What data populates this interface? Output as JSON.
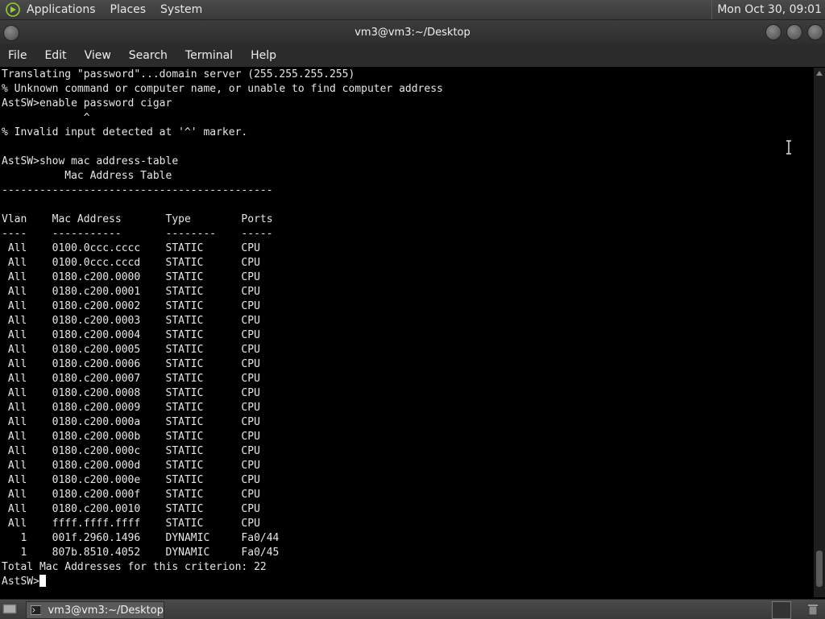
{
  "top_panel": {
    "menus": [
      "Applications",
      "Places",
      "System"
    ],
    "clock": "Mon Oct 30, 09:01"
  },
  "window": {
    "title": "vm3@vm3:~/Desktop"
  },
  "menubar": {
    "items": [
      "File",
      "Edit",
      "View",
      "Search",
      "Terminal",
      "Help"
    ]
  },
  "terminal": {
    "lines": [
      "Translating \"password\"...domain server (255.255.255.255)",
      "% Unknown command or computer name, or unable to find computer address",
      "AstSW>enable password cigar",
      "             ^",
      "% Invalid input detected at '^' marker.",
      "",
      "AstSW>show mac address-table",
      "          Mac Address Table",
      "-------------------------------------------",
      "",
      "Vlan    Mac Address       Type        Ports",
      "----    -----------       --------    -----",
      " All    0100.0ccc.cccc    STATIC      CPU",
      " All    0100.0ccc.cccd    STATIC      CPU",
      " All    0180.c200.0000    STATIC      CPU",
      " All    0180.c200.0001    STATIC      CPU",
      " All    0180.c200.0002    STATIC      CPU",
      " All    0180.c200.0003    STATIC      CPU",
      " All    0180.c200.0004    STATIC      CPU",
      " All    0180.c200.0005    STATIC      CPU",
      " All    0180.c200.0006    STATIC      CPU",
      " All    0180.c200.0007    STATIC      CPU",
      " All    0180.c200.0008    STATIC      CPU",
      " All    0180.c200.0009    STATIC      CPU",
      " All    0180.c200.000a    STATIC      CPU",
      " All    0180.c200.000b    STATIC      CPU",
      " All    0180.c200.000c    STATIC      CPU",
      " All    0180.c200.000d    STATIC      CPU",
      " All    0180.c200.000e    STATIC      CPU",
      " All    0180.c200.000f    STATIC      CPU",
      " All    0180.c200.0010    STATIC      CPU",
      " All    ffff.ffff.ffff    STATIC      CPU",
      "   1    001f.2960.1496    DYNAMIC     Fa0/44",
      "   1    807b.8510.4052    DYNAMIC     Fa0/45",
      "Total Mac Addresses for this criterion: 22"
    ],
    "prompt": "AstSW>"
  },
  "taskbar": {
    "task_label": "vm3@vm3:~/Desktop"
  }
}
